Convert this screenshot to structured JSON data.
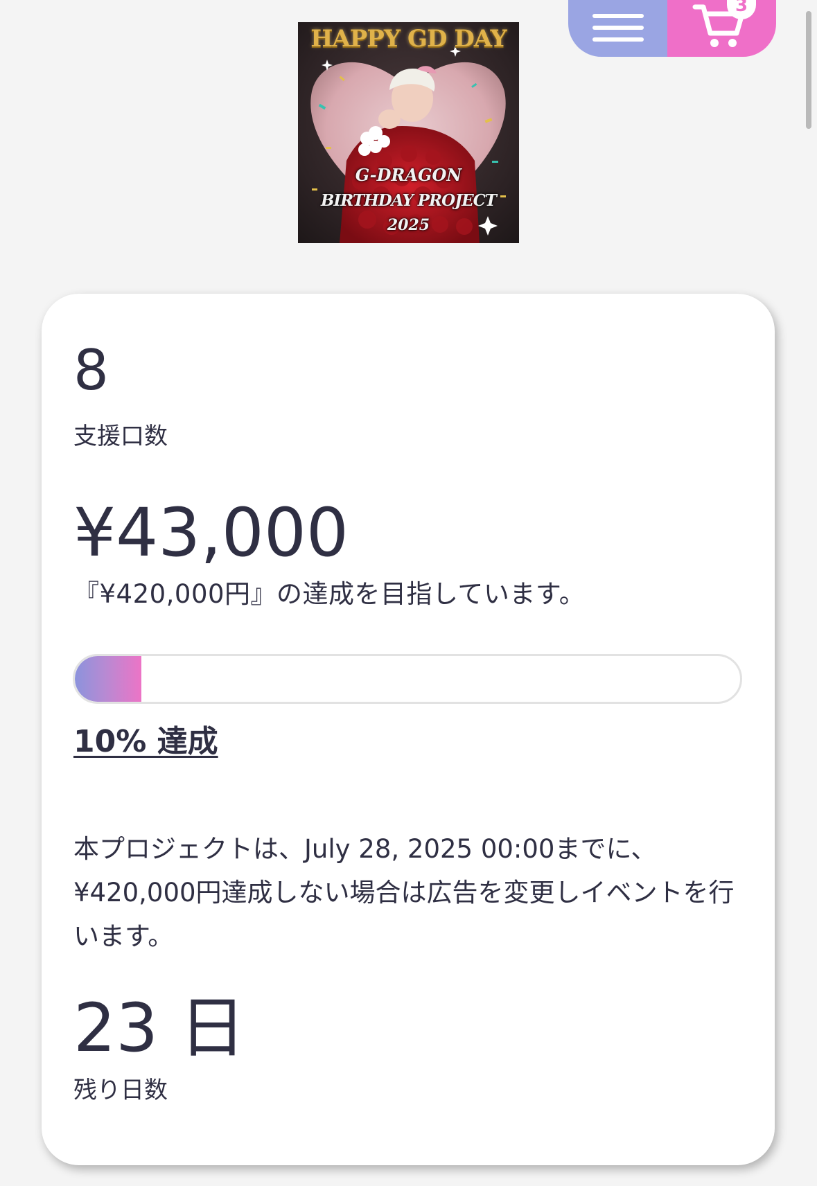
{
  "header": {
    "menu_icon": "hamburger-menu-icon",
    "cart_icon": "cart-icon",
    "cart_count": "3",
    "menu_color": "#9aa5e3",
    "cart_color": "#ef6fc8"
  },
  "project_image": {
    "title": "HAPPY GD DAY",
    "line1": "G-DRAGON",
    "line2": "BIRTHDAY PROJECT",
    "line3": "2025"
  },
  "stats": {
    "backers_count": "8",
    "backers_label": "支援口数",
    "amount": "¥43,000",
    "goal_text": "『¥420,000円』の達成を目指しています。",
    "progress_percent": 10,
    "progress_label": "10% 達成",
    "notice": "本プロジェクトは、July 28, 2025 00:00までに、¥420,000円達成しない場合は広告を変更しイベントを行います。",
    "days_left": "23 日",
    "days_label": "残り日数"
  },
  "colors": {
    "text": "#2f2f43",
    "progress_start": "#8b93dc",
    "progress_end": "#ec74c6"
  }
}
